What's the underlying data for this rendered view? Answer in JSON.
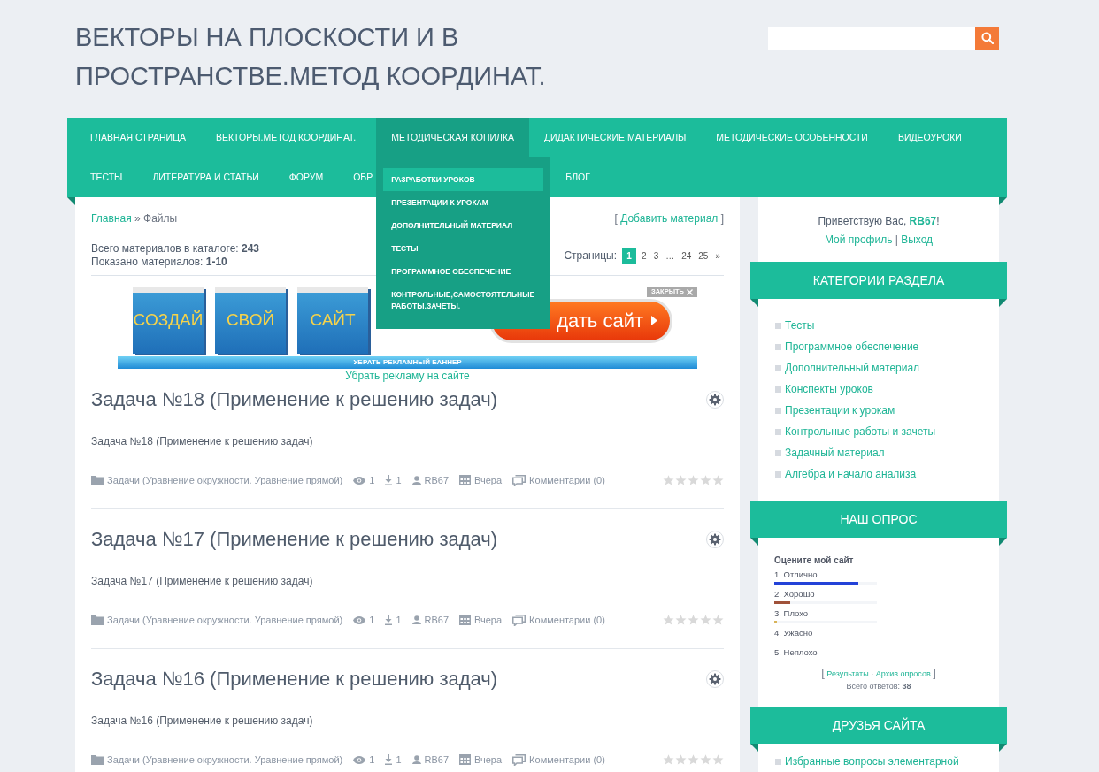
{
  "site_title": "ВЕКТОРЫ НА ПЛОСКОСТИ И В ПРОСТРАНСТВЕ.МЕТОД КООРДИНАТ.",
  "main_menu": {
    "items": [
      {
        "label": "ГЛАВНАЯ СТРАНИЦА",
        "expanded": false
      },
      {
        "label": "ВЕКТОРЫ.МЕТОД КООРДИНАТ.",
        "expanded": false
      },
      {
        "label": "МЕТОДИЧЕСКАЯ КОПИЛКА",
        "expanded": true,
        "submenu": [
          {
            "label": "РАЗРАБОТКИ УРОКОВ",
            "selected": true
          },
          {
            "label": "ПРЕЗЕНТАЦИИ К УРОКАМ",
            "selected": false
          },
          {
            "label": "ДОПОЛНИТЕЛЬНЫЙ МАТЕРИАЛ",
            "selected": false
          },
          {
            "label": "ТЕСТЫ",
            "selected": false
          },
          {
            "label": "ПРОГРАММНОЕ ОБЕСПЕЧЕНИЕ",
            "selected": false
          },
          {
            "label": "КОНТРОЛЬНЫЕ,САМОСТОЯТЕЛЬНЫЕ РАБОТЫ.ЗАЧЕТЫ.",
            "selected": false
          }
        ]
      },
      {
        "label": "ДИДАКТИЧЕСКИЕ МАТЕРИАЛЫ",
        "expanded": false
      },
      {
        "label": "МЕТОДИЧЕСКИЕ ОСОБЕННОСТИ",
        "expanded": false
      },
      {
        "label": "ВИДЕОУРОКИ",
        "expanded": false
      },
      {
        "label": "ТЕСТЫ",
        "expanded": false
      },
      {
        "label": "ЛИТЕРАТУРА И СТАТЬИ",
        "expanded": false
      },
      {
        "label": "ФОРУМ",
        "expanded": false
      },
      {
        "label": "ОБР",
        "expanded": false
      },
      {
        "label": "БЛОГ",
        "expanded": false
      }
    ]
  },
  "breadcrumb": {
    "items": [
      "Главная",
      "Файлы"
    ],
    "separator": "»"
  },
  "add_material": {
    "label": "Добавить материал",
    "brackets": [
      "[",
      "]"
    ]
  },
  "catalog_stats": [
    "Всего материалов в каталоге: **243**",
    "Показано материалов: **1-10**"
  ],
  "pagination": {
    "label": "Страницы:",
    "pages": [
      {
        "label": "1",
        "selected": true
      },
      {
        "label": "2",
        "selected": false
      },
      {
        "label": "3",
        "selected": false
      },
      {
        "label": "…",
        "selected": false
      },
      {
        "label": "24",
        "selected": false
      },
      {
        "label": "25",
        "selected": false
      },
      {
        "label": "»",
        "selected": false
      }
    ]
  },
  "banner": {
    "tiles": [
      "СОЗДАЙ",
      "СВОЙ",
      "САЙТ"
    ],
    "button": "дать сайт",
    "close": "ЗАКРЫТЬ",
    "bar": "УБРАТЬ РЕКЛАМНЫЙ БАННЕР"
  },
  "remove_ads_link": "Убрать рекламу на сайте",
  "posts": [
    {
      "title": "Задача №18 (Применение к решению задач)",
      "description": "Задача №18 (Применение к решению задач)",
      "category": "Задачи (Уравнение окружности. Уравнение прямой)",
      "views": "1",
      "downloads": "1",
      "author": "RB67",
      "date": "Вчера",
      "comments": "Комментарии (0)",
      "stars": 0
    },
    {
      "title": "Задача №17 (Применение к решению задач)",
      "description": "Задача №17 (Применение к решению задач)",
      "category": "Задачи (Уравнение окружности. Уравнение прямой)",
      "views": "1",
      "downloads": "1",
      "author": "RB67",
      "date": "Вчера",
      "comments": "Комментарии (0)",
      "stars": 0
    },
    {
      "title": "Задача №16 (Применение к решению задач)",
      "description": "Задача №16 (Применение к решению задач)",
      "category": "Задачи (Уравнение окружности. Уравнение прямой)",
      "views": "1",
      "downloads": "1",
      "author": "RB67",
      "date": "Вчера",
      "comments": "Комментарии (0)",
      "stars": 0
    }
  ],
  "sidebar": {
    "greeting": "Приветствую Вас, **RB67**!",
    "user_links": [
      "Мой профиль",
      "Выход"
    ],
    "user_links_separator": "|",
    "widgets": [
      {
        "title": "КАТЕГОРИИ РАЗДЕЛА",
        "kind": "list",
        "items": [
          "Тесты",
          "Программное обеспечение",
          "Дополнительный материал",
          "Конспекты уроков",
          "Презентации к урокам",
          "Контрольные работы и зачеты",
          "Задачный материал",
          "Алгебра и начало анализа"
        ]
      },
      {
        "title": "НАШ ОПРОС",
        "kind": "poll",
        "question": "Оцените мой сайт",
        "options": [
          {
            "label": "1. Отлично",
            "level": 0.816,
            "color": "#2342d8"
          },
          {
            "label": "2. Хорошо",
            "level": 0.158,
            "color": "#a0523a"
          },
          {
            "label": "3. Плохо",
            "level": 0.026,
            "color": "#d8b45a"
          },
          {
            "label": "4. Ужасно"
          },
          {
            "label": "5. Неплохо"
          }
        ],
        "links": [
          "Результаты",
          "Архив опросов"
        ],
        "link_separator": "·",
        "brackets": [
          "[",
          "]"
        ],
        "total": "Всего ответов: **38**"
      },
      {
        "title": "ДРУЗЬЯ САЙТА",
        "kind": "list",
        "items": [
          "Избранные вопросы элементарной"
        ]
      }
    ]
  }
}
